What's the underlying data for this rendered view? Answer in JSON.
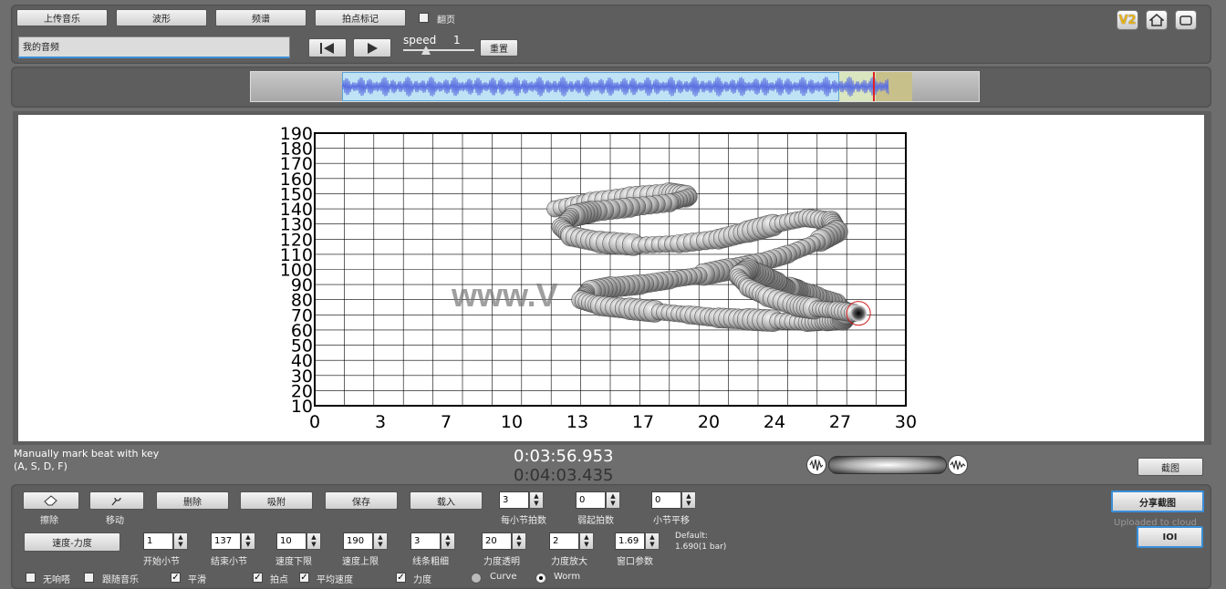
{
  "toolbar": {
    "upload_label": "上传音乐",
    "waveform_label": "波形",
    "spectrum_label": "频谱",
    "beat_mark_label": "拍点标记",
    "page_turn_label": "翻页",
    "audio_name": "我的音频",
    "speed_label": "speed",
    "speed_value": "1",
    "reset_label": "重置",
    "v2_label": "V2"
  },
  "chart_data": {
    "type": "scatter",
    "xticks": [
      "0",
      "3",
      "7",
      "10",
      "13",
      "17",
      "20",
      "24",
      "27",
      "30"
    ],
    "yticks": [
      "190",
      "180",
      "170",
      "160",
      "150",
      "140",
      "130",
      "120",
      "110",
      "100",
      "90",
      "80",
      "70",
      "60",
      "50",
      "40",
      "30",
      "20",
      "10"
    ],
    "xlim": [
      0,
      30
    ],
    "ylim": [
      10,
      190
    ],
    "grid": true,
    "watermark": "www.V",
    "current_point": {
      "x": 27.6,
      "y": 71
    },
    "worm_path_x": [
      12.2,
      14,
      16,
      18,
      19,
      18,
      16,
      14,
      13,
      12.5,
      13,
      14.5,
      16.5,
      18.5,
      20.5,
      22,
      23.5,
      25,
      26.2,
      26.5,
      25.5,
      24,
      22.5,
      21,
      19.5,
      18,
      16.5,
      15,
      13.8,
      13.5,
      14.5,
      16,
      17.5,
      19,
      20.5,
      22,
      23.5,
      25,
      26,
      26.8,
      27,
      26.5,
      25.5,
      24.5,
      24,
      23.5,
      22.8,
      22,
      21.5,
      22,
      23,
      24.5,
      25.5,
      26.5,
      27.5
    ],
    "worm_path_y": [
      140,
      145,
      148,
      150,
      148,
      144,
      141,
      138,
      135,
      128,
      122,
      118,
      116,
      117,
      120,
      125,
      130,
      134,
      132,
      125,
      118,
      110,
      104,
      100,
      96,
      93,
      90,
      88,
      85,
      80,
      76,
      74,
      72,
      70,
      68,
      67,
      66,
      65,
      66,
      67,
      72,
      78,
      82,
      86,
      88,
      92,
      96,
      100,
      95,
      88,
      82,
      76,
      74,
      73,
      71
    ]
  },
  "status": {
    "instruction_line1": "Manually mark beat with key",
    "instruction_line2": "(A, S, D, F)",
    "time_current": "0:03:56.953",
    "time_total": "0:04:03.435",
    "screenshot_label": "截图"
  },
  "controls": {
    "erase_label": "擦除",
    "move_label": "移动",
    "delete_label": "删除",
    "attach_label": "吸附",
    "save_label": "保存",
    "load_label": "载入",
    "beats_per_bar_value": "3",
    "beats_per_bar_label": "每小节拍数",
    "pickup_value": "0",
    "pickup_label": "弱起拍数",
    "bar_shift_value": "0",
    "bar_shift_label": "小节平移",
    "share_label": "分享截图",
    "uploaded_label": "Uploaded to cloud",
    "ioi_label": "IOI",
    "tempo_dynamics_label": "速度-力度",
    "start_bar_value": "1",
    "start_bar_label": "开始小节",
    "end_bar_value": "137",
    "end_bar_label": "结束小节",
    "speed_lower_value": "10",
    "speed_lower_label": "速度下限",
    "speed_upper_value": "190",
    "speed_upper_label": "速度上限",
    "line_width_value": "3",
    "line_width_label": "线条粗细",
    "dyn_transparency_value": "20",
    "dyn_transparency_label": "力度透明",
    "dyn_zoom_value": "2",
    "dyn_zoom_label": "力度放大",
    "window_param_value": "1.69",
    "window_param_label": "窗口参数",
    "default_line1": "Default:",
    "default_line2": "1.690(1 bar)",
    "no_metronome_label": "无响嗒",
    "follow_music_label": "跟随音乐",
    "smooth_label": "平滑",
    "beat_point_label": "拍点",
    "avg_speed_label": "平均速度",
    "dynamics_label": "力度",
    "curve_label": "Curve",
    "worm_label": "Worm"
  }
}
